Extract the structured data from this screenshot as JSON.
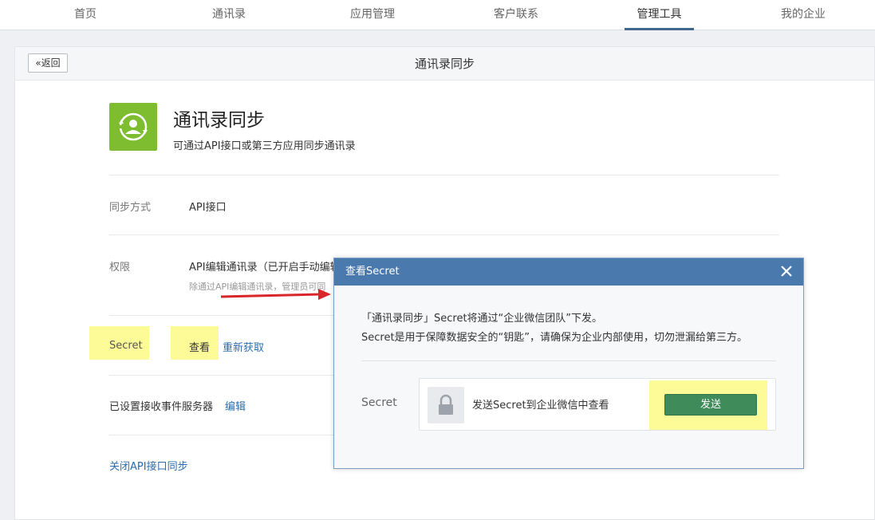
{
  "nav": {
    "items": [
      {
        "label": "首页"
      },
      {
        "label": "通讯录"
      },
      {
        "label": "应用管理"
      },
      {
        "label": "客户联系"
      },
      {
        "label": "管理工具"
      },
      {
        "label": "我的企业"
      }
    ],
    "active_index": 4,
    "active_color": "#41678f"
  },
  "page": {
    "back_label": "返回",
    "title": "通讯录同步"
  },
  "app": {
    "title": "通讯录同步",
    "description": "可通过API接口或第三方应用同步通讯录",
    "icon": "sync-user-icon",
    "icon_color": "#7dbd2f"
  },
  "rows": {
    "sync_method": {
      "label": "同步方式",
      "value": "API接口"
    },
    "permission": {
      "label": "权限",
      "value": "API编辑通讯录（已开启手动编辑",
      "sub": "除通过API编辑通讯录，管理员可同"
    },
    "secret": {
      "label": "Secret",
      "view_link": "查看",
      "regenerate_link": "重新获取"
    },
    "event_server": {
      "label": "已设置接收事件服务器",
      "edit_link": "编辑"
    },
    "close_api": {
      "label": "关闭API接口同步"
    }
  },
  "modal": {
    "title": "查看Secret",
    "line1": "「通讯录同步」Secret将通过“企业微信团队”下发。",
    "line2": "Secret是用于保障数据安全的“钥匙”，请确保为企业内部使用，切勿泄漏给第三方。",
    "secret_label": "Secret",
    "send_text": "发送Secret到企业微信中查看",
    "send_button": "发送",
    "header_color": "#4a79ad",
    "button_color": "#3f8b5a"
  },
  "highlight_color": "#fdfb97",
  "arrow_color": "#d9262b"
}
